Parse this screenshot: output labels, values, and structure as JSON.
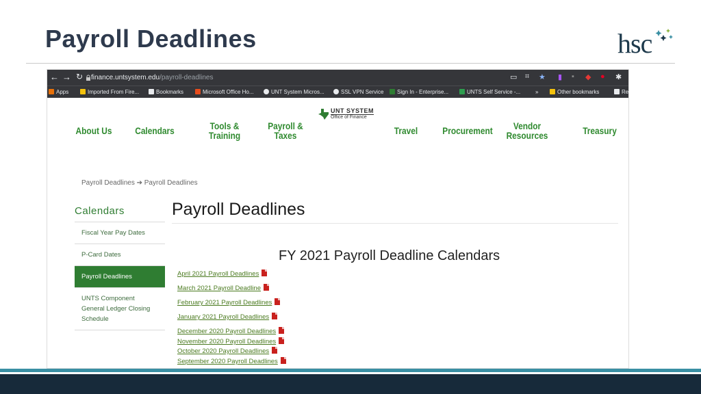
{
  "slide": {
    "title": "Payroll Deadlines",
    "logo_text": "hsc"
  },
  "browser": {
    "url_host": "finance.untsystem.edu",
    "url_path": "/payroll-deadlines",
    "bookmarks": [
      "Apps",
      "Imported From Fire...",
      "Bookmarks",
      "Microsoft Office Ho...",
      "UNT System Micros...",
      "SSL VPN Service",
      "Sign In - Enterprise...",
      "UNTS Self Service -...",
      "»",
      "Other bookmarks",
      "Re"
    ]
  },
  "site": {
    "logo_line1": "UNT SYSTEM",
    "logo_line2": "Office of Finance",
    "nav": [
      "About Us",
      "Calendars",
      "Tools & Training",
      "Payroll & Taxes",
      "Travel",
      "Procurement",
      "Vendor Resources",
      "Treasury"
    ],
    "breadcrumb": "Payroll Deadlines  ➔  Payroll Deadlines",
    "sidebar_heading": "Calendars",
    "sidebar_items": [
      "Fiscal Year Pay Dates",
      "P-Card Dates",
      "Payroll Deadlines",
      "UNTS Component General Ledger Closing Schedule"
    ],
    "page_heading": "Payroll Deadlines",
    "section_heading": "FY 2021 Payroll Deadline Calendars",
    "links": [
      "April 2021 Payroll Deadlines",
      "March 2021 Payroll Deadline",
      "February 2021 Payroll Deadlines",
      "January 2021 Payroll Deadlines",
      "December 2020 Payroll Deadlines",
      "November 2020 Payroll Deadlines",
      "October 2020 Payroll Deadlines",
      "September 2020 Payroll Deadlines"
    ]
  },
  "colors": {
    "accent_green": "#2f7d32",
    "title_navy": "#2e3a4d",
    "band_teal": "#3a8fa3",
    "band_dark": "#172a3a",
    "pdf_red": "#c9211e"
  }
}
